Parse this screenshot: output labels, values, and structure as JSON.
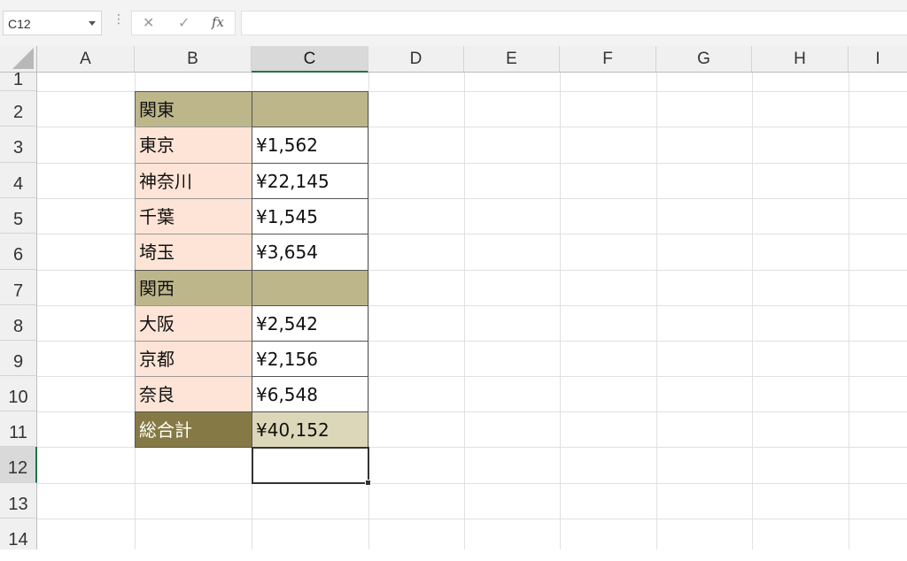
{
  "formula_bar": {
    "name_box": "C12",
    "cancel_glyph": "✕",
    "enter_glyph": "✓",
    "fx_label": "fx",
    "formula": ""
  },
  "columns": [
    "A",
    "B",
    "C",
    "D",
    "E",
    "F",
    "G",
    "H",
    "I"
  ],
  "rows": [
    "1",
    "2",
    "3",
    "4",
    "5",
    "6",
    "7",
    "8",
    "9",
    "10",
    "11",
    "12",
    "13",
    "14"
  ],
  "selected_cell": "C12",
  "table": {
    "region_east": "関東",
    "east_rows": [
      {
        "pref": "東京",
        "value": "¥1,562"
      },
      {
        "pref": "神奈川",
        "value": "¥22,145"
      },
      {
        "pref": "千葉",
        "value": "¥1,545"
      },
      {
        "pref": "埼玉",
        "value": "¥3,654"
      }
    ],
    "region_west": "関西",
    "west_rows": [
      {
        "pref": "大阪",
        "value": "¥2,542"
      },
      {
        "pref": "京都",
        "value": "¥2,156"
      },
      {
        "pref": "奈良",
        "value": "¥6,548"
      }
    ],
    "total_label": "総合計",
    "total_value": "¥40,152"
  },
  "colors": {
    "region_fill": "#bdb68b",
    "pref_fill": "#fde4d6",
    "total_label_fill": "#857a45",
    "total_value_fill": "#ddd7b9",
    "selection_accent": "#217346"
  }
}
